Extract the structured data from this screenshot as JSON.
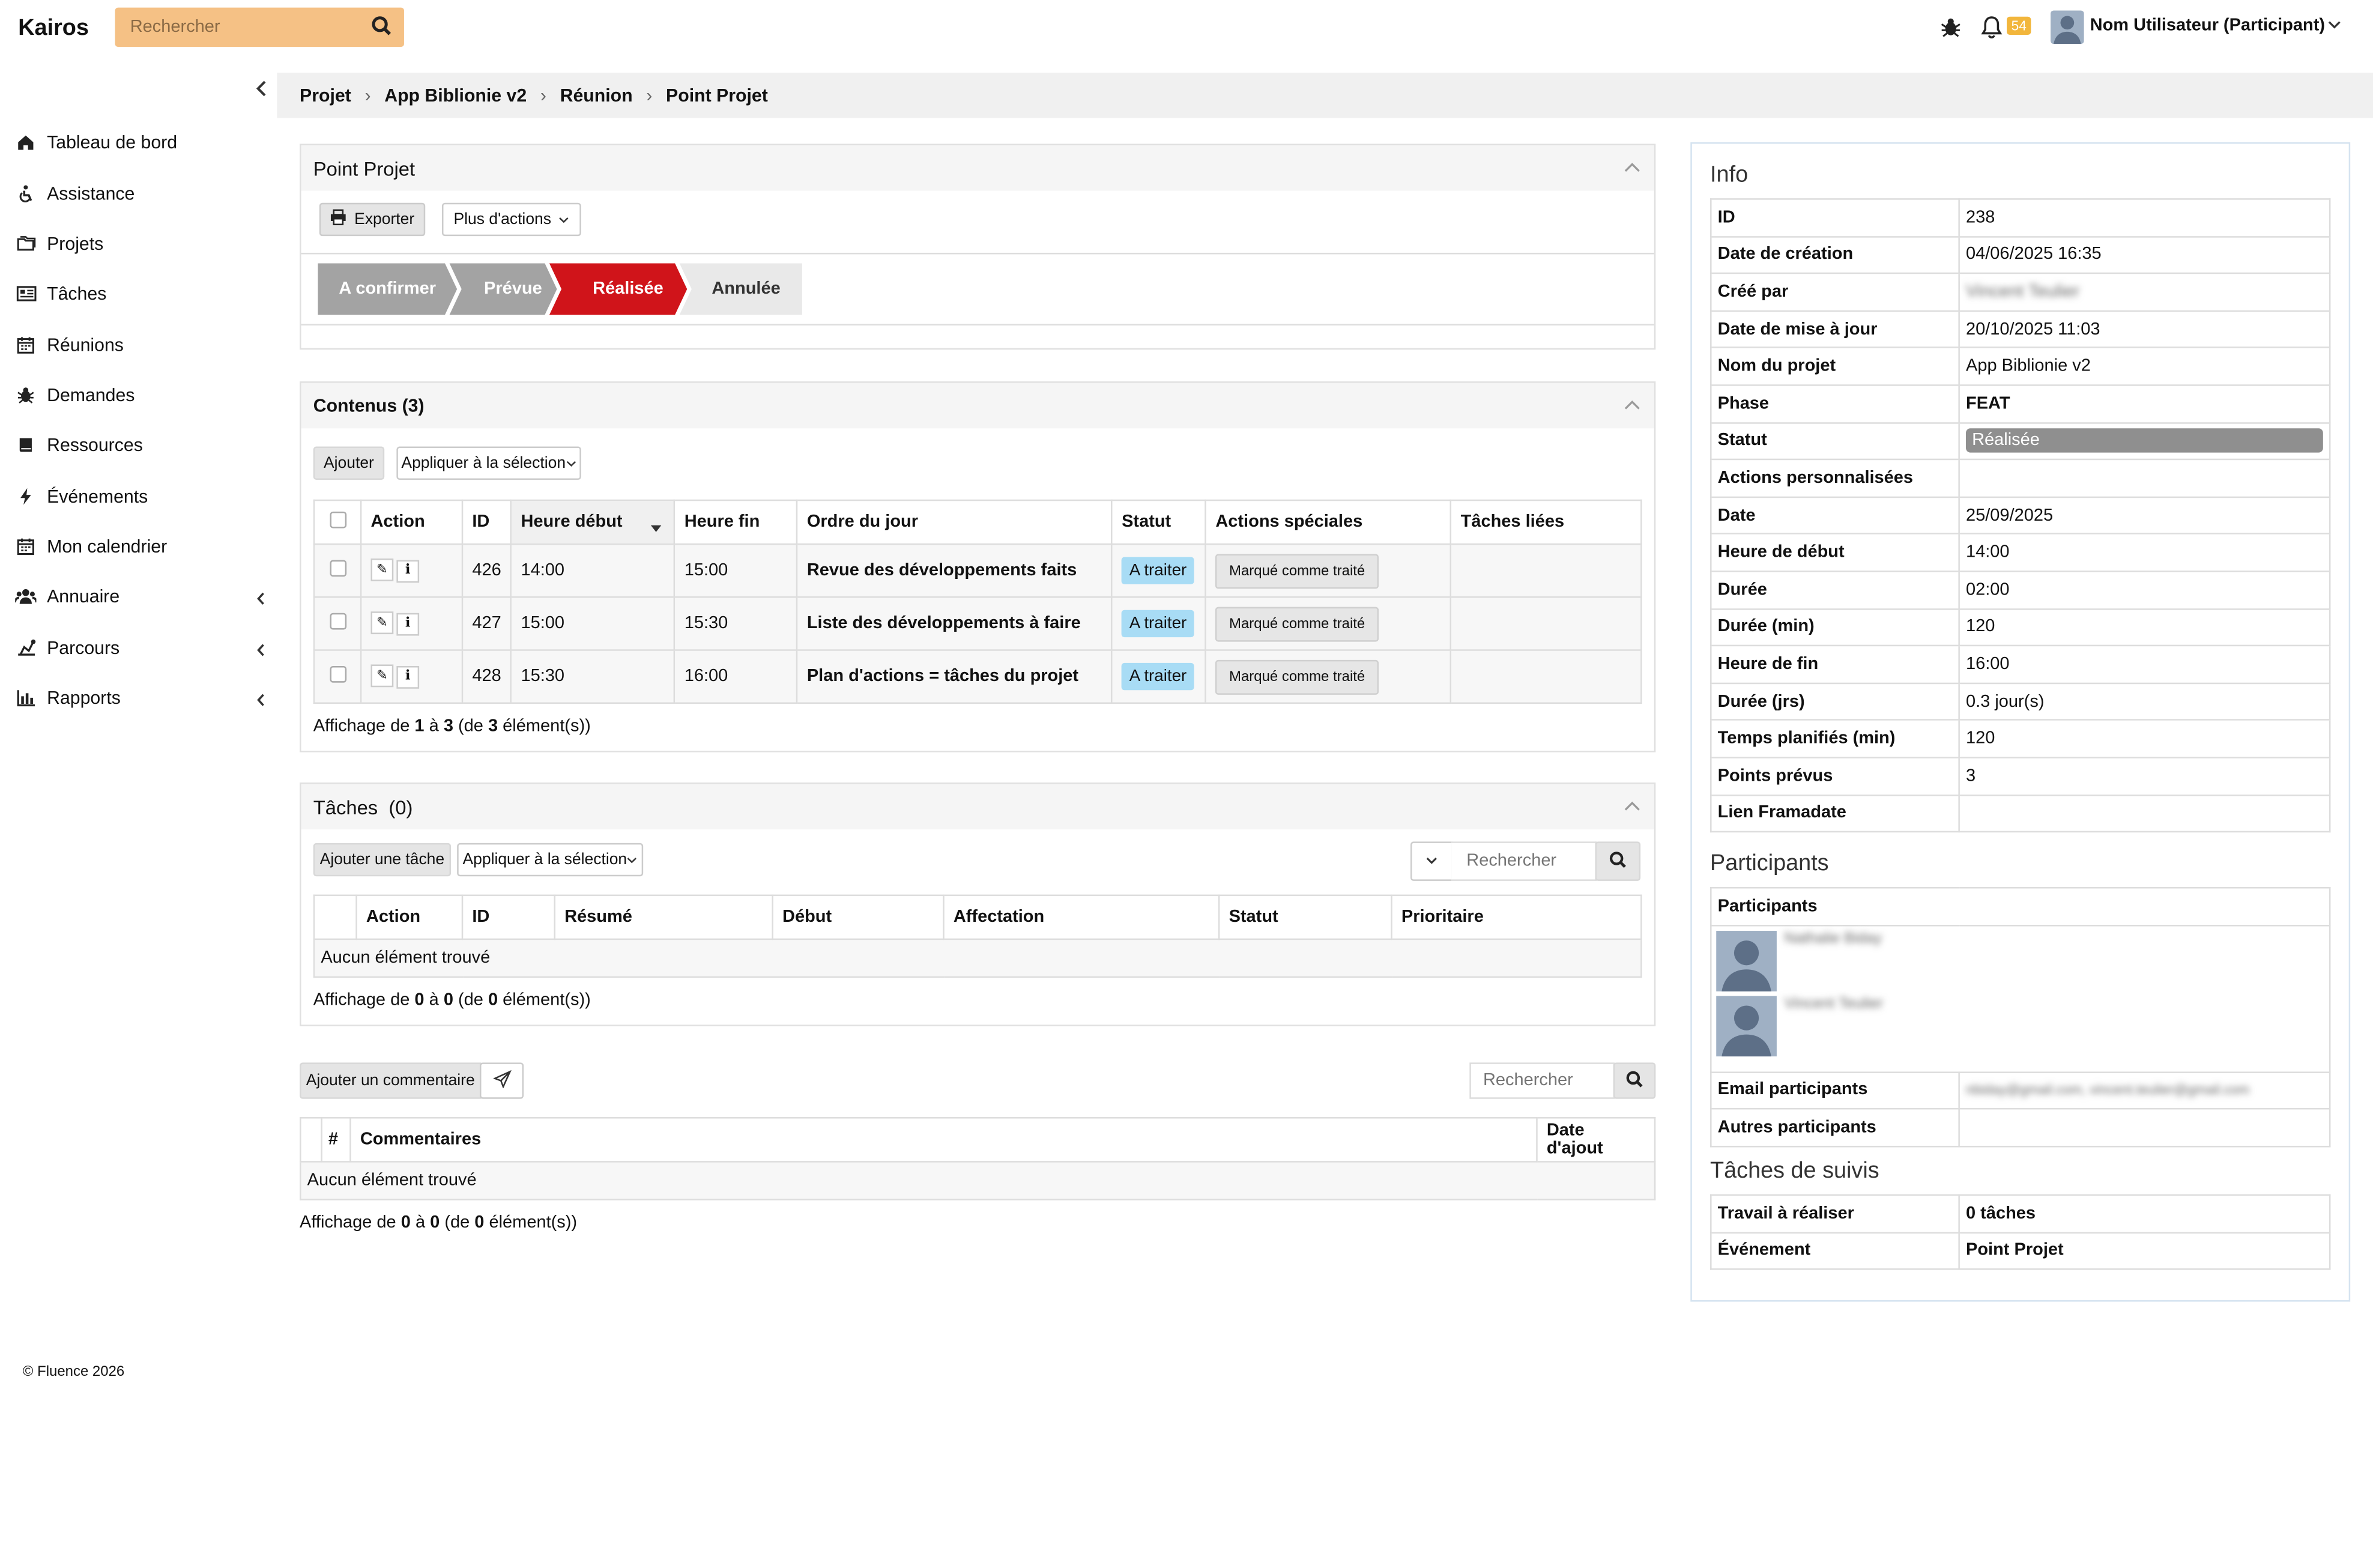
{
  "header": {
    "brand": "Kairos",
    "search_placeholder": "Rechercher",
    "notif_count": "54",
    "user_name": "Nom Utilisateur (Participant)"
  },
  "sidebar": {
    "items": [
      {
        "label": "Tableau de bord",
        "icon": "home-icon"
      },
      {
        "label": "Assistance",
        "icon": "accessibility-icon"
      },
      {
        "label": "Projets",
        "icon": "folders-icon"
      },
      {
        "label": "Tâches",
        "icon": "tasks-icon"
      },
      {
        "label": "Réunions",
        "icon": "calendar-icon"
      },
      {
        "label": "Demandes",
        "icon": "bug-icon"
      },
      {
        "label": "Ressources",
        "icon": "book-icon"
      },
      {
        "label": "Événements",
        "icon": "bolt-icon"
      },
      {
        "label": "Mon calendrier",
        "icon": "calendar-icon"
      },
      {
        "label": "Annuaire",
        "icon": "users-icon"
      },
      {
        "label": "Parcours",
        "icon": "route-icon"
      },
      {
        "label": "Rapports",
        "icon": "bar-chart-icon"
      }
    ]
  },
  "breadcrumb": [
    "Projet",
    "App Biblionie v2",
    "Réunion",
    "Point Projet"
  ],
  "meeting": {
    "title": "Point Projet",
    "export_label": "Exporter",
    "more_actions_label": "Plus d'actions",
    "steps": [
      "A confirmer",
      "Prévue",
      "Réalisée",
      "Annulée"
    ],
    "step_colors": {
      "done": "#a3a3a3",
      "active": "#d0141a",
      "next": "#e9e9e9"
    }
  },
  "contenus": {
    "title": "Contenus (3)",
    "add_label": "Ajouter",
    "apply_label": "Appliquer à la sélection",
    "columns": [
      "Action",
      "ID",
      "Heure début",
      "Heure fin",
      "Ordre du jour",
      "Statut",
      "Actions spéciales",
      "Tâches liées"
    ],
    "rows": [
      {
        "id": "426",
        "start": "14:00",
        "end": "15:00",
        "agenda": "Revue des développements faits",
        "status": "A traiter",
        "special": "Marqué comme traité"
      },
      {
        "id": "427",
        "start": "15:00",
        "end": "15:30",
        "agenda": "Liste des développements à faire",
        "status": "A traiter",
        "special": "Marqué comme traité"
      },
      {
        "id": "428",
        "start": "15:30",
        "end": "16:00",
        "agenda": "Plan d'actions = tâches du projet",
        "status": "A traiter",
        "special": "Marqué comme traité"
      }
    ],
    "footer": {
      "prefix": "Affichage de ",
      "from": "1",
      "to_word": " à ",
      "to": "3",
      "of_word": " (de ",
      "total": "3",
      "suffix": " élément(s))"
    }
  },
  "taches": {
    "title": "Tâches  (0)",
    "add_label": "Ajouter une tâche",
    "apply_label": "Appliquer à la sélection",
    "search_placeholder": "Rechercher",
    "columns": [
      "Action",
      "ID",
      "Résumé",
      "Début",
      "Affectation",
      "Statut",
      "Prioritaire"
    ],
    "empty": "Aucun élément trouvé",
    "footer": {
      "prefix": "Affichage de ",
      "from": "0",
      "to_word": " à ",
      "to": "0",
      "of_word": " (de ",
      "total": "0",
      "suffix": " élément(s))"
    }
  },
  "comments": {
    "add_label": "Ajouter un commentaire",
    "search_placeholder": "Rechercher",
    "columns": [
      "#",
      "Commentaires",
      "Date d'ajout"
    ],
    "empty": "Aucun élément trouvé",
    "footer": {
      "prefix": "Affichage de ",
      "from": "0",
      "to_word": " à ",
      "to": "0",
      "of_word": " (de ",
      "total": "0",
      "suffix": " élément(s))"
    }
  },
  "info": {
    "title": "Info",
    "rows": [
      {
        "k": "ID",
        "v": "238"
      },
      {
        "k": "Date de création",
        "v": "04/06/2025 16:35"
      },
      {
        "k": "Créé par",
        "v": "Vincent Teulier",
        "blur": true
      },
      {
        "k": "Date de mise à jour",
        "v": "20/10/2025 11:03"
      },
      {
        "k": "Nom du projet",
        "v": "App Biblionie v2"
      },
      {
        "k": "Phase",
        "v": "FEAT",
        "bold": true
      },
      {
        "k": "Statut",
        "v": "Réalisée",
        "pill": true
      },
      {
        "k": "Actions personnalisées",
        "v": ""
      },
      {
        "k": "Date",
        "v": "25/09/2025"
      },
      {
        "k": "Heure de début",
        "v": "14:00"
      },
      {
        "k": "Durée",
        "v": "02:00"
      },
      {
        "k": "Durée (min)",
        "v": "120"
      },
      {
        "k": "Heure de fin",
        "v": "16:00"
      },
      {
        "k": "Durée (jrs)",
        "v": "0.3 jour(s)"
      },
      {
        "k": "Temps planifiés (min)",
        "v": "120"
      },
      {
        "k": "Points prévus",
        "v": "3"
      },
      {
        "k": "Lien Framadate",
        "v": ""
      }
    ],
    "participants_title": "Participants",
    "participants_header": "Participants",
    "participants": [
      "Nathalie Biday",
      "Vincent Teulier"
    ],
    "email_label": "Email participants",
    "email_value": "nbiday@gmail.com, vincent.teulier@gmail.com",
    "other_label": "Autres participants",
    "other_value": "",
    "followup_title": "Tâches de suivis",
    "followup": [
      {
        "k": "Travail à réaliser",
        "v": "0 tâches"
      },
      {
        "k": "Événement",
        "v": "Point Projet"
      }
    ]
  },
  "footer": "© Fluence 2026"
}
